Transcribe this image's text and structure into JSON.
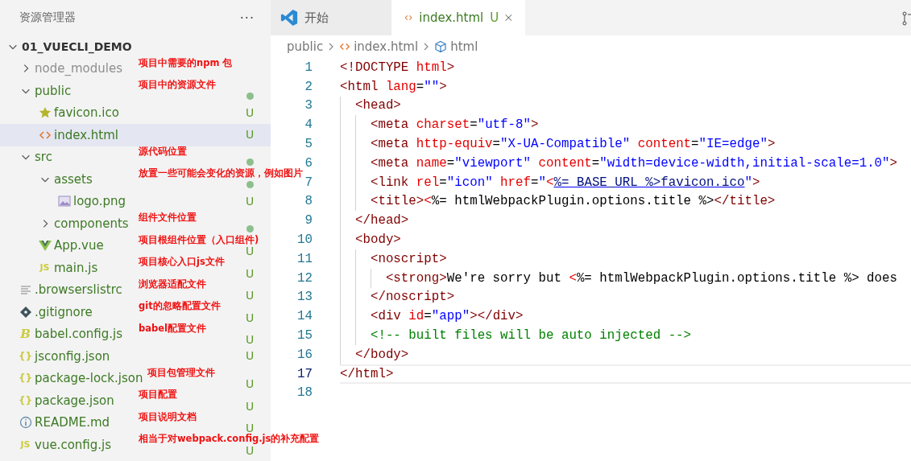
{
  "sidebar": {
    "title": "资源管理器",
    "more": "···",
    "tree": [
      {
        "name": "01_VUECLI_DEMO",
        "kind": "root",
        "expanded": true,
        "selected": false,
        "children": [
          {
            "name": "node_modules",
            "kind": "folder",
            "expanded": false,
            "selected": false,
            "ignored": true,
            "note": "项目中需要的npm 包"
          },
          {
            "name": "public",
            "kind": "folder",
            "expanded": true,
            "selected": false,
            "modified": true,
            "note": "项目中的资源文件",
            "children": [
              {
                "name": "favicon.ico",
                "kind": "favicon",
                "selected": false,
                "badge": "U"
              },
              {
                "name": "index.html",
                "kind": "html",
                "selected": true,
                "badge": "U"
              }
            ]
          },
          {
            "name": "src",
            "kind": "folder",
            "expanded": true,
            "selected": false,
            "modified": true,
            "note": "源代码位置",
            "children": [
              {
                "name": "assets",
                "kind": "folder",
                "expanded": true,
                "selected": false,
                "modified": true,
                "note": "放置一些可能会变化的资源，例如图片",
                "children": [
                  {
                    "name": "logo.png",
                    "kind": "image",
                    "selected": false,
                    "badge": "U"
                  }
                ]
              },
              {
                "name": "components",
                "kind": "folder",
                "expanded": false,
                "selected": false,
                "modified": true,
                "note": "组件文件位置"
              },
              {
                "name": "App.vue",
                "kind": "vue",
                "selected": false,
                "badge": "U",
                "note": "项目根组件位置（入口组件)"
              },
              {
                "name": "main.js",
                "kind": "js",
                "icon_text": "JS",
                "selected": false,
                "badge": "U",
                "note": "项目核心入口js文件"
              }
            ]
          },
          {
            "name": ".browserslistrc",
            "kind": "list",
            "selected": false,
            "badge": "U",
            "note": "浏览器适配文件"
          },
          {
            "name": ".gitignore",
            "kind": "git",
            "selected": false,
            "badge": "U",
            "note": "git的忽略配置文件"
          },
          {
            "name": "babel.config.js",
            "kind": "babel",
            "icon_text": "B",
            "selected": false,
            "badge": "U",
            "note": "babel配置文件"
          },
          {
            "name": "jsconfig.json",
            "kind": "json",
            "icon_text": "{}",
            "selected": false,
            "badge": "U"
          },
          {
            "name": "package-lock.json",
            "kind": "json",
            "icon_text": "{}",
            "selected": false,
            "badge": "U",
            "note": "项目包管理文件"
          },
          {
            "name": "package.json",
            "kind": "json",
            "icon_text": "{}",
            "selected": false,
            "badge": "U",
            "note": "项目配置"
          },
          {
            "name": "README.md",
            "kind": "info",
            "selected": false,
            "badge": "U",
            "note": "项目说明文档"
          },
          {
            "name": "vue.config.js",
            "kind": "js",
            "icon_text": "JS",
            "selected": false,
            "badge": "U",
            "note": "相当于对webpack.config.js的补充配置"
          }
        ]
      }
    ]
  },
  "tabs": [
    {
      "label": "开始",
      "kind": "welcome",
      "selected": false
    },
    {
      "label": "index.html",
      "kind": "html",
      "badge": "U",
      "selected": true
    }
  ],
  "breadcrumb": [
    {
      "label": "public",
      "kind": "folder"
    },
    {
      "label": "index.html",
      "kind": "html"
    },
    {
      "label": "html",
      "kind": "element"
    }
  ],
  "code": [
    {
      "n": "1",
      "current": false,
      "tokens": [
        {
          "text": "<!DOCTYPE",
          "kind": "tag"
        },
        {
          "text": " html",
          "kind": "attr"
        },
        {
          "text": ">",
          "kind": "tag"
        }
      ]
    },
    {
      "n": "2",
      "current": false,
      "tokens": [
        {
          "text": "<html",
          "kind": "tag"
        },
        {
          "text": " lang",
          "kind": "attr"
        },
        {
          "text": "=",
          "kind": "plain"
        },
        {
          "text": "\"\"",
          "kind": "str"
        },
        {
          "text": ">",
          "kind": "tag"
        }
      ]
    },
    {
      "n": "3",
      "current": false,
      "tokens": [
        {
          "text": "  <head>",
          "kind": "tag"
        }
      ]
    },
    {
      "n": "4",
      "current": false,
      "tokens": [
        {
          "text": "    <meta",
          "kind": "tag"
        },
        {
          "text": " charset",
          "kind": "attr"
        },
        {
          "text": "=",
          "kind": "plain"
        },
        {
          "text": "\"utf-8\"",
          "kind": "str"
        },
        {
          "text": ">",
          "kind": "tag"
        }
      ]
    },
    {
      "n": "5",
      "current": false,
      "tokens": [
        {
          "text": "    <meta",
          "kind": "tag"
        },
        {
          "text": " http-equiv",
          "kind": "attr"
        },
        {
          "text": "=",
          "kind": "plain"
        },
        {
          "text": "\"X-UA-Compatible\"",
          "kind": "str"
        },
        {
          "text": " content",
          "kind": "attr"
        },
        {
          "text": "=",
          "kind": "plain"
        },
        {
          "text": "\"IE=edge\"",
          "kind": "str"
        },
        {
          "text": ">",
          "kind": "tag"
        }
      ]
    },
    {
      "n": "6",
      "current": false,
      "tokens": [
        {
          "text": "    <meta",
          "kind": "tag"
        },
        {
          "text": " name",
          "kind": "attr"
        },
        {
          "text": "=",
          "kind": "plain"
        },
        {
          "text": "\"viewport\"",
          "kind": "str"
        },
        {
          "text": " content",
          "kind": "attr"
        },
        {
          "text": "=",
          "kind": "plain"
        },
        {
          "text": "\"width=device-width,initial-scale=1.0\"",
          "kind": "str"
        },
        {
          "text": ">",
          "kind": "tag"
        }
      ]
    },
    {
      "n": "7",
      "current": false,
      "tokens": [
        {
          "text": "    <link",
          "kind": "tag"
        },
        {
          "text": " rel",
          "kind": "attr"
        },
        {
          "text": "=",
          "kind": "plain"
        },
        {
          "text": "\"icon\"",
          "kind": "str"
        },
        {
          "text": " href",
          "kind": "attr"
        },
        {
          "text": "=",
          "kind": "plain"
        },
        {
          "text": "\"",
          "kind": "str"
        },
        {
          "text": "<",
          "kind": "templ"
        },
        {
          "text": "%= BASE_URL %>favicon.ico",
          "kind": "link"
        },
        {
          "text": "\"",
          "kind": "str"
        },
        {
          "text": ">",
          "kind": "tag"
        }
      ]
    },
    {
      "n": "8",
      "current": false,
      "tokens": [
        {
          "text": "    <title>",
          "kind": "tag"
        },
        {
          "text": "<",
          "kind": "templ"
        },
        {
          "text": "%= htmlWebpackPlugin.options.title %>",
          "kind": "plain"
        },
        {
          "text": "</title>",
          "kind": "tag"
        }
      ]
    },
    {
      "n": "9",
      "current": false,
      "tokens": [
        {
          "text": "  </head>",
          "kind": "tag"
        }
      ]
    },
    {
      "n": "10",
      "current": false,
      "tokens": [
        {
          "text": "  <body>",
          "kind": "tag"
        }
      ]
    },
    {
      "n": "11",
      "current": false,
      "tokens": [
        {
          "text": "    <noscript>",
          "kind": "tag"
        }
      ]
    },
    {
      "n": "12",
      "current": false,
      "tokens": [
        {
          "text": "      <strong>",
          "kind": "tag"
        },
        {
          "text": "We're sorry but ",
          "kind": "plain"
        },
        {
          "text": "<",
          "kind": "templ"
        },
        {
          "text": "%= htmlWebpackPlugin.options.title %> does",
          "kind": "plain"
        }
      ]
    },
    {
      "n": "13",
      "current": false,
      "tokens": [
        {
          "text": "    </noscript>",
          "kind": "tag"
        }
      ]
    },
    {
      "n": "14",
      "current": false,
      "tokens": [
        {
          "text": "    <div",
          "kind": "tag"
        },
        {
          "text": " id",
          "kind": "attr"
        },
        {
          "text": "=",
          "kind": "plain"
        },
        {
          "text": "\"app\"",
          "kind": "str"
        },
        {
          "text": "></div>",
          "kind": "tag"
        }
      ]
    },
    {
      "n": "15",
      "current": false,
      "tokens": [
        {
          "text": "    <!-- built files will be auto injected -->",
          "kind": "comment"
        }
      ]
    },
    {
      "n": "16",
      "current": false,
      "tokens": [
        {
          "text": "  </body>",
          "kind": "tag"
        }
      ]
    },
    {
      "n": "17",
      "current": true,
      "tokens": [
        {
          "text": "</html>",
          "kind": "tag"
        }
      ]
    },
    {
      "n": "18",
      "current": false
    }
  ]
}
